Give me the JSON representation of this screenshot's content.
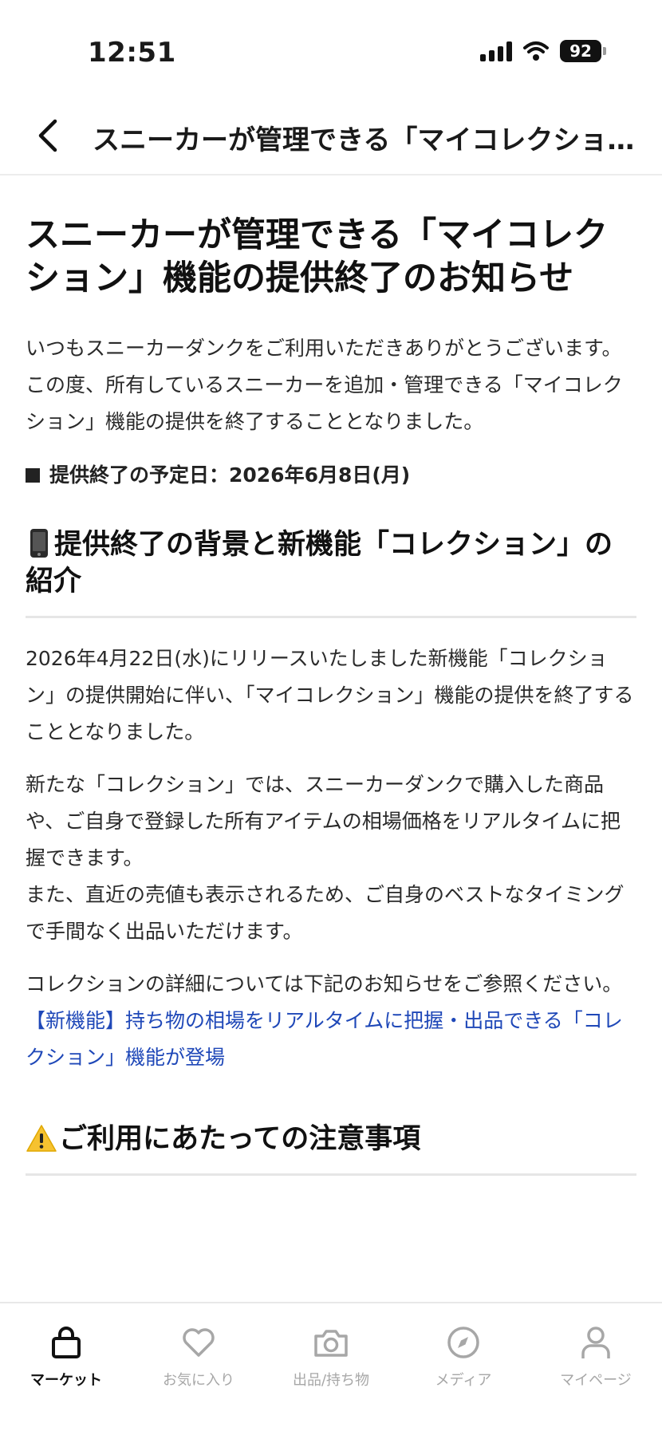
{
  "status_bar": {
    "time": "12:51",
    "battery": "92"
  },
  "header": {
    "title": "スニーカーが管理できる「マイコレクショ…"
  },
  "article": {
    "title": "スニーカーが管理できる「マイコレクション」機能の提供終了のお知らせ",
    "intro": "いつもスニーカーダンクをご利用いただきありがとうございます。\nこの度、所有しているスニーカーを追加・管理できる「マイコレクション」機能の提供を終了することとなりました。",
    "end_date": "提供終了の予定日：2026年6月8日(月)",
    "section1_heading": "提供終了の背景と新機能「コレクション」の紹介",
    "section1_p1": "2026年4月22日(水)にリリースいたしました新機能「コレクション」の提供開始に伴い、「マイコレクション」機能の提供を終了することとなりました。",
    "section1_p2": "新たな「コレクション」では、スニーカーダンクで購入した商品や、ご自身で登録した所有アイテムの相場価格をリアルタイムに把握できます。\nまた、直近の売値も表示されるため、ご自身のベストなタイミングで手間なく出品いただけます。",
    "section1_p3": "コレクションの詳細については下記のお知らせをご参照ください。",
    "section1_link": "【新機能】持ち物の相場をリアルタイムに把握・出品できる「コレクション」機能が登場",
    "section2_heading": "ご利用にあたっての注意事項"
  },
  "tabs": [
    {
      "label": "マーケット",
      "icon": "shopping-bag-icon",
      "active": true
    },
    {
      "label": "お気に入り",
      "icon": "heart-icon",
      "active": false
    },
    {
      "label": "出品/持ち物",
      "icon": "camera-icon",
      "active": false
    },
    {
      "label": "メディア",
      "icon": "compass-icon",
      "active": false
    },
    {
      "label": "マイページ",
      "icon": "person-icon",
      "active": false
    }
  ],
  "colors": {
    "link": "#1f48b8",
    "inactive_tab": "#a7a7a7",
    "active_tab": "#111111"
  }
}
